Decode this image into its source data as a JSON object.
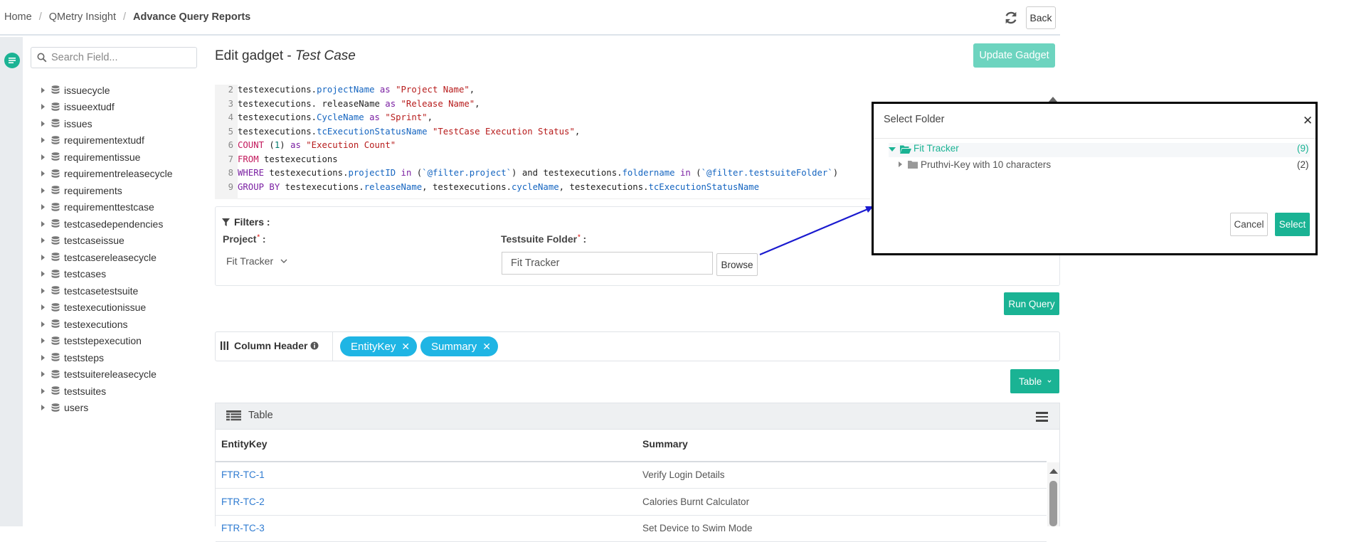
{
  "breadcrumb": {
    "home": "Home",
    "section": "QMetry Insight",
    "current": "Advance Query Reports"
  },
  "header": {
    "back_label": "Back"
  },
  "search": {
    "placeholder": "Search Field..."
  },
  "fields": [
    "issuecycle",
    "issueextudf",
    "issues",
    "requirementextudf",
    "requirementissue",
    "requirementreleasecycle",
    "requirements",
    "requirementtestcase",
    "testcasedependencies",
    "testcaseissue",
    "testcasereleasecycle",
    "testcases",
    "testcasetestsuite",
    "testexecutionissue",
    "testexecutions",
    "teststepexecution",
    "teststeps",
    "testsuitereleasecycle",
    "testsuites",
    "users"
  ],
  "gadget": {
    "title_prefix": "Edit gadget - ",
    "title_entity": "Test Case",
    "update_label": "Update Gadget"
  },
  "code": {
    "line_numbers": [
      "2",
      "3",
      "4",
      "5",
      "6",
      "7",
      "8",
      "9"
    ]
  },
  "filters": {
    "title": "Filters :",
    "project_label": "Project",
    "project_value": "Fit Tracker",
    "suite_label": "Testsuite Folder",
    "suite_value": "Fit Tracker",
    "browse_label": "Browse"
  },
  "run_query_label": "Run Query",
  "column_header": {
    "label": "Column Header",
    "chips": [
      "EntityKey",
      "Summary"
    ]
  },
  "view_select": {
    "label": "Table"
  },
  "table": {
    "title": "Table",
    "columns": [
      "EntityKey",
      "Summary"
    ],
    "rows": [
      {
        "key": "FTR-TC-1",
        "summary": "Verify Login Details"
      },
      {
        "key": "FTR-TC-2",
        "summary": "Calories Burnt Calculator"
      },
      {
        "key": "FTR-TC-3",
        "summary": "Set Device to Swim Mode"
      }
    ]
  },
  "modal": {
    "title": "Select Folder",
    "root_label": "Fit Tracker",
    "root_count": "(9)",
    "child_label": "Pruthvi-Key with 10 characters",
    "child_count": "(2)",
    "cancel_label": "Cancel",
    "select_label": "Select"
  },
  "colors": {
    "accent": "#1ab394",
    "chip": "#1fb5e4",
    "link": "#2f7bd1",
    "arrow": "#1a1acf"
  }
}
